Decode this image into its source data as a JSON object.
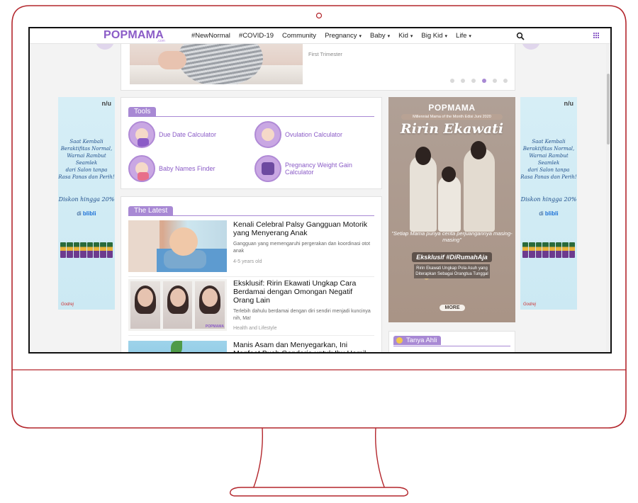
{
  "nav": {
    "logo": "POPMAMA",
    "logo_sub": ".com",
    "items": [
      {
        "label": "#NewNormal",
        "caret": false
      },
      {
        "label": "#COVID-19",
        "caret": false
      },
      {
        "label": "Community",
        "caret": false
      },
      {
        "label": "Pregnancy",
        "caret": true
      },
      {
        "label": "Baby",
        "caret": true
      },
      {
        "label": "Kid",
        "caret": true
      },
      {
        "label": "Big Kid",
        "caret": true
      },
      {
        "label": "Life",
        "caret": true
      }
    ],
    "caret_glyph": "▾",
    "search_icon": "search-icon",
    "apps_icon": "grid-icon"
  },
  "carousel": {
    "tag": "First Trimester",
    "dots_total": 6,
    "active_dot": 3
  },
  "ad": {
    "brand": "n/u",
    "script_lines": [
      "Saat Kembali",
      "Beraktifitas Normal,",
      "Warnai Rambut Seamlek",
      "dari Salon tanpa",
      "Rasa Panas dan Perih!"
    ],
    "discount": "Diskon hingga 20%",
    "shop_prefix": "di",
    "shop_name": "blibli",
    "footer": "Godrej"
  },
  "tools": {
    "title": "Tools",
    "items": [
      {
        "label": "Due Date Calculator"
      },
      {
        "label": "Ovulation Calculator"
      },
      {
        "label": "Baby Names Finder"
      },
      {
        "label": "Pregnancy Weight Gain Calculator"
      }
    ]
  },
  "latest": {
    "title": "The Latest",
    "articles": [
      {
        "title": "Kenali Celebral Palsy Gangguan Motorik yang Menyerang Anak",
        "summary": "Gangguan yang memengaruhi pergerakan dan koordinasi otot anak",
        "meta": "4-5 years old"
      },
      {
        "title": "Eksklusif: Ririn Ekawati Ungkap Cara Berdamai dengan Omongan Negatif Orang Lain",
        "summary": "Terlebih dahulu berdamai dengan diri sendiri menjadi kuncinya nih, Ma!",
        "meta": "Health and Lifestyle",
        "watermark": "POPMAMA"
      },
      {
        "title": "Manis Asam dan Menyegarkan, Ini Manfaat Buah Gandaria untuk Ibu Hamil"
      }
    ]
  },
  "promo": {
    "logo": "POPMAMA",
    "subtitle": "Millennial Mama of the Month Edisi Juni 2020",
    "name": "Ririn Ekawati",
    "quote": "\"Setiap Mama punya cerita perjuangannya masing-masing\"",
    "exclusive": "Eksklusif #DiRumahAja",
    "description": "Ririn Ekawati Ungkap Pola Asuh yang Diterapkan Sebagai Orangtua Tunggal",
    "more": "MORE"
  },
  "ask": {
    "title": "Tanya Ahli"
  },
  "colors": {
    "brand": "#8b5cc7",
    "accent": "#a889d4",
    "monitor": "#c0392b"
  }
}
